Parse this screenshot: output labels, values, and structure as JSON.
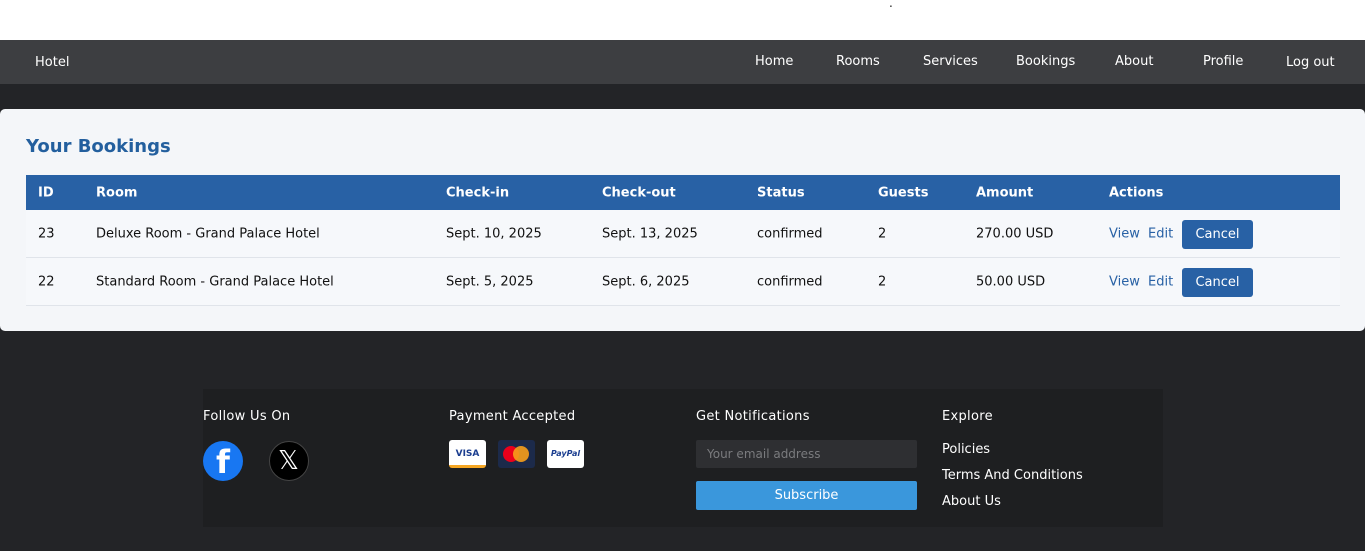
{
  "top": {
    "dot": "."
  },
  "nav": {
    "brand": "Hotel",
    "links": [
      "Home",
      "Rooms",
      "Services",
      "Bookings",
      "About",
      "Profile",
      "Log out"
    ]
  },
  "bookings": {
    "title": "Your Bookings",
    "headers": [
      "ID",
      "Room",
      "Check-in",
      "Check-out",
      "Status",
      "Guests",
      "Amount",
      "Actions"
    ],
    "rows": [
      {
        "id": "23",
        "room": "Deluxe Room - Grand Palace Hotel",
        "check_in": "Sept. 10, 2025",
        "check_out": "Sept. 13, 2025",
        "status": "confirmed",
        "guests": "2",
        "amount": "270.00 USD"
      },
      {
        "id": "22",
        "room": "Standard Room - Grand Palace Hotel",
        "check_in": "Sept. 5, 2025",
        "check_out": "Sept. 6, 2025",
        "status": "confirmed",
        "guests": "2",
        "amount": "50.00 USD"
      }
    ],
    "actions": {
      "view": "View",
      "edit": "Edit",
      "cancel": "Cancel"
    }
  },
  "footer": {
    "follow_title": "Follow Us On",
    "payment_title": "Payment Accepted",
    "payment_methods": {
      "visa": "VISA",
      "paypal": "PayPal"
    },
    "notify_title": "Get Notifications",
    "email_placeholder": "Your email address",
    "subscribe_label": "Subscribe",
    "explore_title": "Explore",
    "explore_links": [
      "Policies",
      "Terms And Conditions",
      "About Us"
    ]
  },
  "colors": {
    "primary": "#2861a5",
    "subscribe": "#3a97dc",
    "navbar": "#3d3e41",
    "page_bg": "#232427"
  },
  "icons": [
    "facebook-icon",
    "x-icon",
    "visa-icon",
    "mastercard-icon",
    "paypal-icon"
  ]
}
